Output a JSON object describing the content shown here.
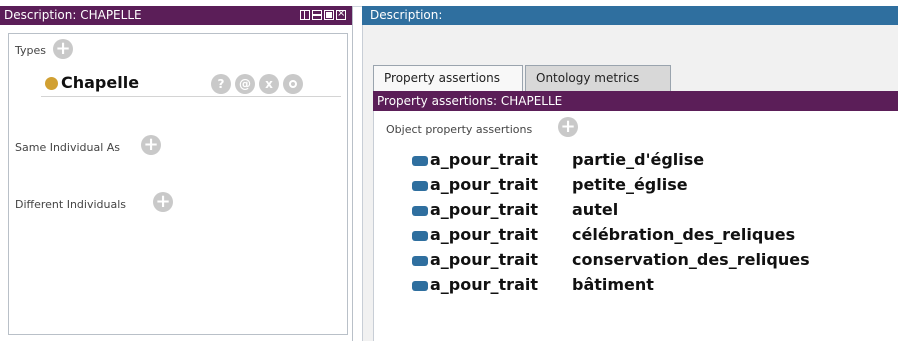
{
  "left_panel": {
    "title": "Description: CHAPELLE",
    "sections": {
      "types_label": "Types",
      "same_individual_label": "Same Individual As",
      "different_individuals_label": "Different Individuals"
    },
    "type_entry": {
      "name": "Chapelle",
      "actions": [
        "?",
        "@",
        "x",
        "o"
      ]
    }
  },
  "right_panel": {
    "title": "Description:",
    "tabs": [
      "Property assertions",
      "Ontology metrics"
    ],
    "active_tab": "Property assertions",
    "property_header": "Property assertions: CHAPELLE",
    "object_property_label": "Object property assertions",
    "assertions": [
      {
        "property": "a_pour_trait",
        "value": "partie_d'église"
      },
      {
        "property": "a_pour_trait",
        "value": "petite_église"
      },
      {
        "property": "a_pour_trait",
        "value": "autel"
      },
      {
        "property": "a_pour_trait",
        "value": "célébration_des_reliques"
      },
      {
        "property": "a_pour_trait",
        "value": "conservation_des_reliques"
      },
      {
        "property": "a_pour_trait",
        "value": "bâtiment"
      }
    ]
  },
  "icons": {
    "add": "plus-circle-icon",
    "individual": "individual-dot-icon",
    "object_property": "object-property-icon",
    "window_controls": [
      "tile-icon",
      "minimize-icon",
      "maximize-icon",
      "close-icon"
    ]
  },
  "colors": {
    "purple_header": "#5b1e58",
    "blue_header": "#2f6f9f",
    "individual_dot": "#d1a032",
    "button_gray": "#c9c9c9"
  }
}
